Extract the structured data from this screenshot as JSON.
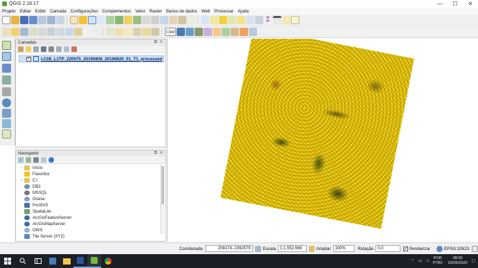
{
  "window": {
    "title": "QGIS 2.18.17",
    "min": "—",
    "max": "☐",
    "close": "✕"
  },
  "menu": [
    "Projeto",
    "Editar",
    "Exibir",
    "Camada",
    "Configurações",
    "Complementos",
    "Vetor",
    "Raster",
    "Banco de dados",
    "Web",
    "Processar",
    "Ajuda"
  ],
  "toolbar_labels": {
    "csw": "CSW",
    "sigma": "Σ"
  },
  "layers_panel": {
    "title": "Camadas",
    "controls": "⧉ ✕",
    "layer": {
      "name": "LC08_L1TP_220075_20190808_20190820_01_T1_processed",
      "checked": true
    }
  },
  "navigator_panel": {
    "title": "Navegador",
    "controls": "⧉ ✕",
    "items": [
      {
        "label": "Início",
        "arrow": "›",
        "icon": "folder-icon",
        "color": "#e8c25a"
      },
      {
        "label": "Favoritos",
        "arrow": "",
        "icon": "star-icon",
        "color": "#f2c21a"
      },
      {
        "label": "C:/",
        "arrow": "›",
        "icon": "folder-icon",
        "color": "#e8c25a"
      },
      {
        "label": "DB2",
        "arrow": "",
        "icon": "database-icon",
        "color": "#6b8fb5"
      },
      {
        "label": "MSSQL",
        "arrow": "",
        "icon": "database-icon",
        "color": "#7a7a7a"
      },
      {
        "label": "Oracle",
        "arrow": "",
        "icon": "database-icon",
        "color": "#8aa0b8"
      },
      {
        "label": "PostGIS",
        "arrow": "",
        "icon": "elephant-icon",
        "color": "#4a6fa5"
      },
      {
        "label": "SpatiaLite",
        "arrow": "",
        "icon": "feather-icon",
        "color": "#7a9a6a"
      },
      {
        "label": "ArcGisFeatureServer",
        "arrow": "",
        "icon": "globe-icon",
        "color": "#3d6ea8"
      },
      {
        "label": "ArcGisMapServer",
        "arrow": "",
        "icon": "globe-icon",
        "color": "#3d6ea8"
      },
      {
        "label": "OWS",
        "arrow": "",
        "icon": "globe-icon",
        "color": "#9ab0c8"
      },
      {
        "label": "Tile Server (XYZ)",
        "arrow": "",
        "icon": "grid-icon",
        "color": "#5a8ac0"
      }
    ]
  },
  "status": {
    "coord_label": "Coordenada",
    "coord_value": "208174,-2392579",
    "scale_label": "Escala",
    "scale_value": "1:1.552.568",
    "zoom_label": "Ampliar",
    "zoom_value": "100%",
    "rotation_label": "Rotação",
    "rotation_value": "0,0",
    "render_label": "Renderizar",
    "crs": "EPSG:32623"
  },
  "taskbar": {
    "lang1": "POR",
    "lang2": "PTB2",
    "time": "08:55",
    "date": "02/06/2020"
  },
  "colors": {
    "raster_base": "#e4c20c",
    "selection": "#cfe3f7",
    "taskbar": "#1b1f26"
  }
}
